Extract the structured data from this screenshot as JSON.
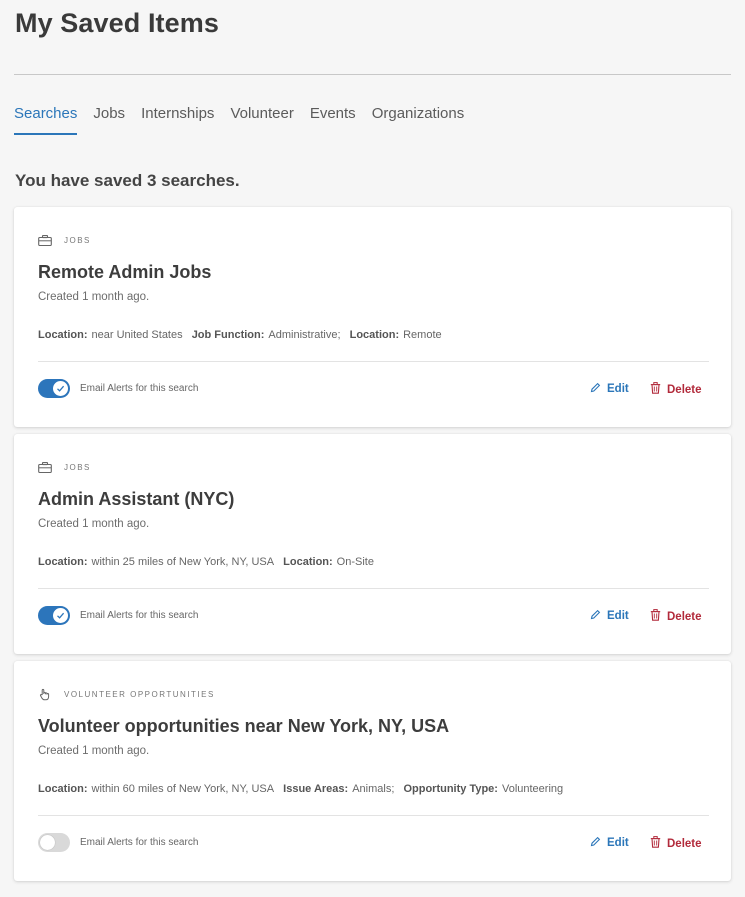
{
  "page": {
    "title": "My Saved Items"
  },
  "tabs": [
    {
      "label": "Searches",
      "active": true
    },
    {
      "label": "Jobs",
      "active": false
    },
    {
      "label": "Internships",
      "active": false
    },
    {
      "label": "Volunteer",
      "active": false
    },
    {
      "label": "Events",
      "active": false
    },
    {
      "label": "Organizations",
      "active": false
    }
  ],
  "summary": "You have saved 3 searches.",
  "colors": {
    "accent": "#2b76b9",
    "danger": "#b22a3b",
    "toggle_on": "#2c75bb",
    "toggle_off": "#d9d9d9"
  },
  "cards": [
    {
      "type_label": "JOBS",
      "type_icon": "briefcase-icon",
      "title": "Remote Admin Jobs",
      "created": "Created 1 month ago.",
      "criteria": [
        {
          "key": "Location:",
          "value": "near United States"
        },
        {
          "key": "Job Function:",
          "value": "Administrative;"
        },
        {
          "key": "Location:",
          "value": "Remote"
        }
      ],
      "alerts_on": true,
      "toggle_label": "Email Alerts for this search",
      "edit_label": "Edit",
      "delete_label": "Delete"
    },
    {
      "type_label": "JOBS",
      "type_icon": "briefcase-icon",
      "title": "Admin Assistant (NYC)",
      "created": "Created 1 month ago.",
      "criteria": [
        {
          "key": "Location:",
          "value": "within 25 miles of New York, NY, USA"
        },
        {
          "key": "Location:",
          "value": "On-Site"
        }
      ],
      "alerts_on": true,
      "toggle_label": "Email Alerts for this search",
      "edit_label": "Edit",
      "delete_label": "Delete"
    },
    {
      "type_label": "VOLUNTEER OPPORTUNITIES",
      "type_icon": "hand-icon",
      "title": "Volunteer opportunities near New York, NY, USA",
      "created": "Created 1 month ago.",
      "criteria": [
        {
          "key": "Location:",
          "value": "within 60 miles of New York, NY, USA"
        },
        {
          "key": "Issue Areas:",
          "value": "Animals;"
        },
        {
          "key": "Opportunity Type:",
          "value": "Volunteering"
        }
      ],
      "alerts_on": false,
      "toggle_label": "Email Alerts for this search",
      "edit_label": "Edit",
      "delete_label": "Delete"
    }
  ]
}
